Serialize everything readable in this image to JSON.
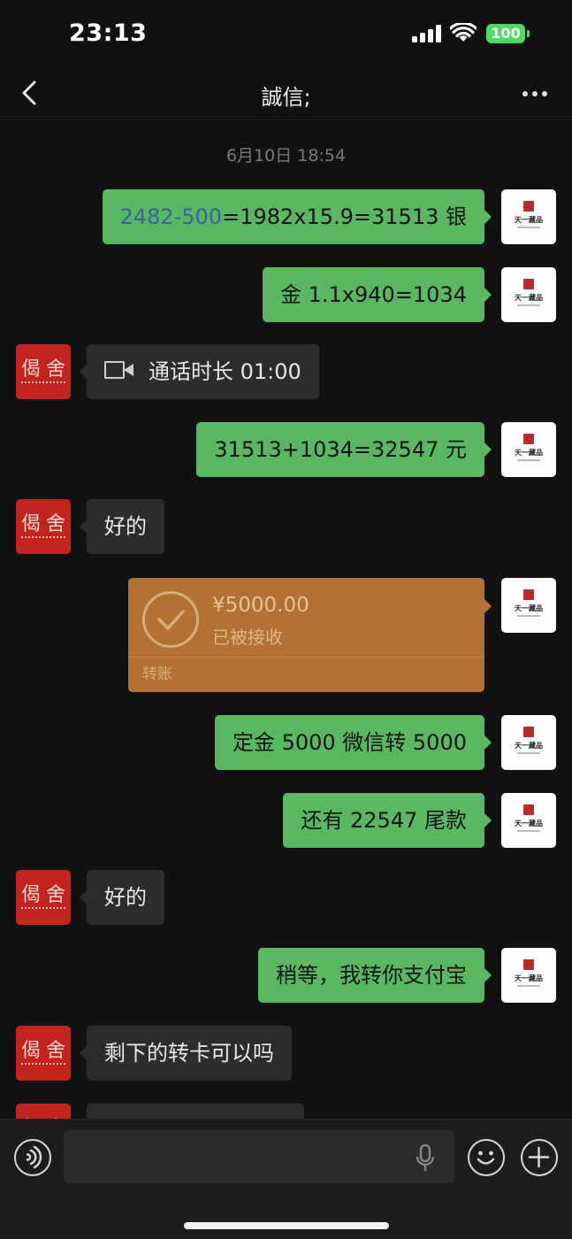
{
  "status_bar": {
    "time": "23:13",
    "battery": "100"
  },
  "nav": {
    "title": "誠信;"
  },
  "chat": {
    "timestamp": "6月10日 18:54",
    "messages": [
      {
        "from": "self",
        "link": "2482-500",
        "text": "=1982x15.9=31513 银"
      },
      {
        "from": "self",
        "text": "金 1.1x940=1034"
      },
      {
        "from": "other",
        "type": "call",
        "text": "通话时长 01:00"
      },
      {
        "from": "self",
        "text": "31513+1034=32547 元"
      },
      {
        "from": "other",
        "text": "好的"
      },
      {
        "from": "self",
        "type": "transfer",
        "amount": "¥5000.00",
        "status": "已被接收",
        "label": "转账"
      },
      {
        "from": "self",
        "text": "定金 5000 微信转 5000"
      },
      {
        "from": "self",
        "text": "还有 22547 尾款"
      },
      {
        "from": "other",
        "text": "好的"
      },
      {
        "from": "self",
        "text": "稍等，我转你支付宝"
      },
      {
        "from": "other",
        "text": "剩下的转卡可以吗"
      }
    ]
  },
  "avatars": {
    "self": {
      "brand": "天一藏品"
    },
    "other": {
      "glyph_left": "偈",
      "glyph_right": "舍"
    }
  },
  "input": {
    "value": ""
  },
  "colors": {
    "sent_bubble": "#5ab863",
    "recv_bubble": "#2c2c2c",
    "transfer": "#b17232",
    "link": "#3d5f9e",
    "background": "#111111"
  }
}
